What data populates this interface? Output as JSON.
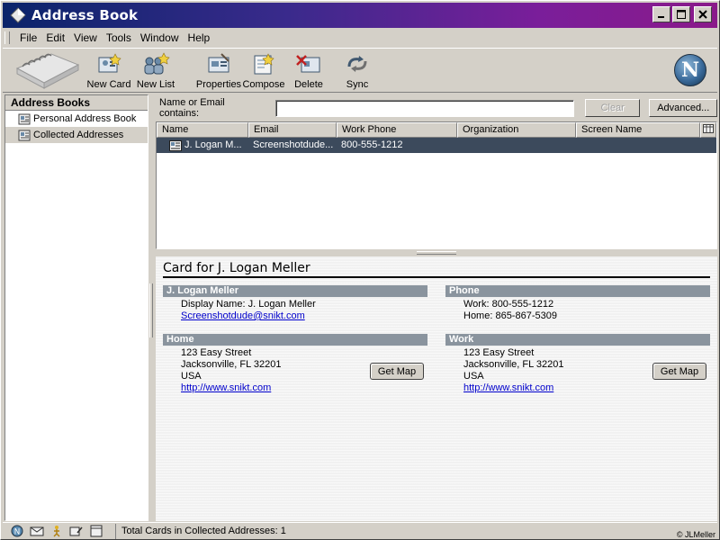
{
  "window": {
    "title": "Address Book"
  },
  "menu": [
    "File",
    "Edit",
    "View",
    "Tools",
    "Window",
    "Help"
  ],
  "toolbar": {
    "buttons": [
      {
        "label": "New Card",
        "icon": "new-card-icon"
      },
      {
        "label": "New List",
        "icon": "new-list-icon"
      },
      {
        "label": "Properties",
        "icon": "properties-icon"
      },
      {
        "label": "Compose",
        "icon": "compose-icon"
      },
      {
        "label": "Delete",
        "icon": "delete-icon"
      },
      {
        "label": "Sync",
        "icon": "sync-icon"
      }
    ],
    "throbber": "N"
  },
  "sidebar": {
    "header": "Address Books",
    "items": [
      {
        "label": "Personal Address Book",
        "selected": false
      },
      {
        "label": "Collected Addresses",
        "selected": true
      }
    ]
  },
  "search": {
    "label": "Name or Email contains:",
    "value": "",
    "clear_label": "Clear",
    "advanced_label": "Advanced..."
  },
  "table": {
    "columns": [
      "Name",
      "Email",
      "Work Phone",
      "Organization",
      "Screen Name"
    ],
    "rows": [
      {
        "name": "J. Logan M...",
        "email": "Screenshotdude...",
        "work_phone": "800-555-1212",
        "organization": "",
        "screen_name": ""
      }
    ]
  },
  "card": {
    "title": "Card for J. Logan Meller",
    "name_section": {
      "header": "J. Logan Meller",
      "display_name": "Display Name: J. Logan Meller",
      "email": "Screenshotdude@snikt.com"
    },
    "phone_section": {
      "header": "Phone",
      "work": "Work: 800-555-1212",
      "home": "Home: 865-867-5309"
    },
    "home_section": {
      "header": "Home",
      "street": "123 Easy Street",
      "city": "Jacksonville, FL 32201",
      "country": "USA",
      "url": "http://www.snikt.com",
      "map_button": "Get Map"
    },
    "work_section": {
      "header": "Work",
      "street": "123 Easy Street",
      "city": "Jacksonville, FL 32201",
      "country": "USA",
      "url": "http://www.snikt.com",
      "map_button": "Get Map"
    }
  },
  "status": {
    "text": "Total Cards in Collected Addresses: 1",
    "copyright": "© JLMeller"
  },
  "colors": {
    "title_start": "#0a246a",
    "title_end": "#8a1a8a",
    "selected_row": "#3c4a5c",
    "section_header": "#8a949e",
    "link": "#0000cc"
  }
}
